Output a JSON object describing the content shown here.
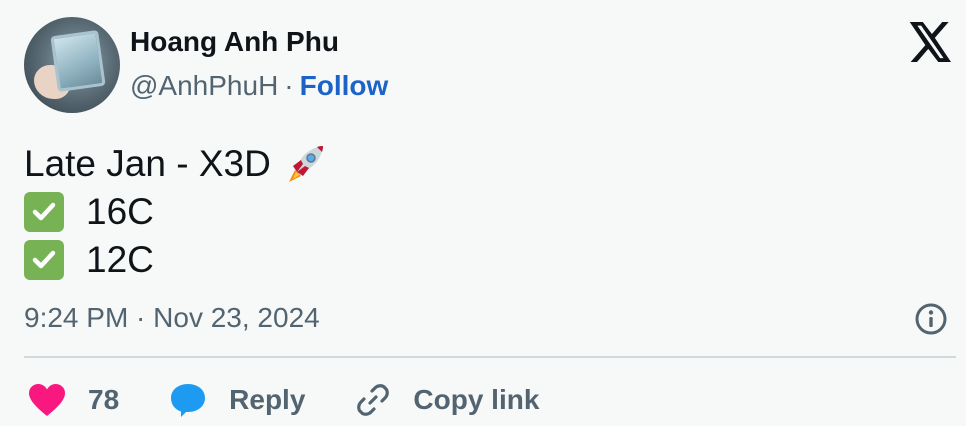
{
  "author": {
    "name": "Hoang Anh Phu",
    "handle": "@AnhPhuH",
    "separator": "·",
    "follow_label": "Follow"
  },
  "tweet": {
    "lines": [
      {
        "icon": "rocket-icon",
        "text": "Late Jan - X3D"
      },
      {
        "icon": "check-mark-button-icon",
        "text": "16C"
      },
      {
        "icon": "check-mark-button-icon",
        "text": "12C"
      }
    ]
  },
  "timestamp": "9:24 PM · Nov 23, 2024",
  "actions": {
    "likes": {
      "icon": "heart-icon",
      "count": "78"
    },
    "reply": {
      "icon": "reply-bubble-icon",
      "label": "Reply"
    },
    "copy_link": {
      "icon": "link-icon",
      "label": "Copy link"
    }
  },
  "icons": {
    "brand": "x-logo-icon",
    "info": "info-icon"
  },
  "colors": {
    "background": "#f7f9f9",
    "follow": "#1d63c7",
    "heart": "#f91880",
    "reply": "#1d9bf0",
    "check": "#77b255",
    "secondary_text": "#536471"
  }
}
